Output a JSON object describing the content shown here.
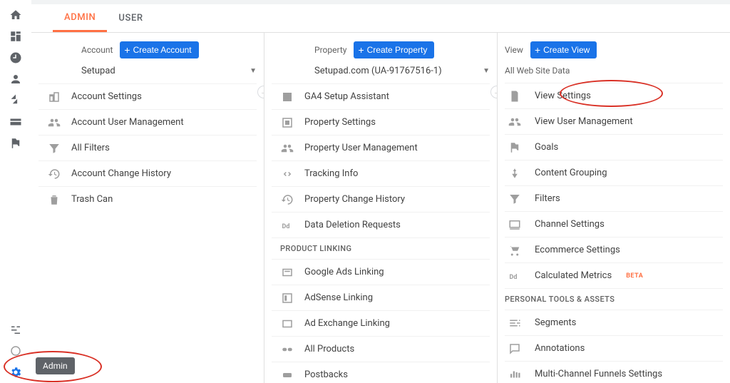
{
  "tabs": {
    "admin": "ADMIN",
    "user": "USER"
  },
  "sidebar_tooltip": "Admin",
  "account": {
    "label": "Account",
    "create": "Create Account",
    "selected": "Setupad",
    "items": [
      {
        "icon": "building-icon",
        "label": "Account Settings"
      },
      {
        "icon": "people-icon",
        "label": "Account User Management"
      },
      {
        "icon": "filter-icon",
        "label": "All Filters"
      },
      {
        "icon": "history-icon",
        "label": "Account Change History"
      },
      {
        "icon": "trash-icon",
        "label": "Trash Can"
      }
    ]
  },
  "property": {
    "label": "Property",
    "create": "Create Property",
    "selected": "Setupad.com (UA-91767516-1)",
    "section_product_linking": "PRODUCT LINKING",
    "items1": [
      {
        "icon": "check-square-icon",
        "label": "GA4 Setup Assistant"
      },
      {
        "icon": "settings-square-icon",
        "label": "Property Settings"
      },
      {
        "icon": "people-icon",
        "label": "Property User Management"
      },
      {
        "icon": "code-icon",
        "label": "Tracking Info"
      },
      {
        "icon": "history-icon",
        "label": "Property Change History"
      },
      {
        "icon": "dd-icon",
        "label": "Data Deletion Requests"
      }
    ],
    "items2": [
      {
        "icon": "ads-square-icon",
        "label": "Google Ads Linking"
      },
      {
        "icon": "adsense-icon",
        "label": "AdSense Linking"
      },
      {
        "icon": "adx-icon",
        "label": "Ad Exchange Linking"
      },
      {
        "icon": "link-icon",
        "label": "All Products"
      },
      {
        "icon": "postbacks-icon",
        "label": "Postbacks"
      }
    ]
  },
  "view": {
    "label": "View",
    "create": "Create View",
    "selected": "All Web Site Data",
    "section_personal": "PERSONAL TOOLS & ASSETS",
    "beta": "BETA",
    "items1": [
      {
        "icon": "page-icon",
        "label": "View Settings"
      },
      {
        "icon": "people-icon",
        "label": "View User Management"
      },
      {
        "icon": "flag-icon",
        "label": "Goals"
      },
      {
        "icon": "grouping-icon",
        "label": "Content Grouping"
      },
      {
        "icon": "filter-icon",
        "label": "Filters"
      },
      {
        "icon": "channel-icon",
        "label": "Channel Settings"
      },
      {
        "icon": "cart-icon",
        "label": "Ecommerce Settings"
      },
      {
        "icon": "dd-icon",
        "label": "Calculated Metrics",
        "beta": true
      }
    ],
    "items2": [
      {
        "icon": "segments-icon",
        "label": "Segments"
      },
      {
        "icon": "annotations-icon",
        "label": "Annotations"
      },
      {
        "icon": "mcf-icon",
        "label": "Multi-Channel Funnels Settings"
      }
    ]
  }
}
